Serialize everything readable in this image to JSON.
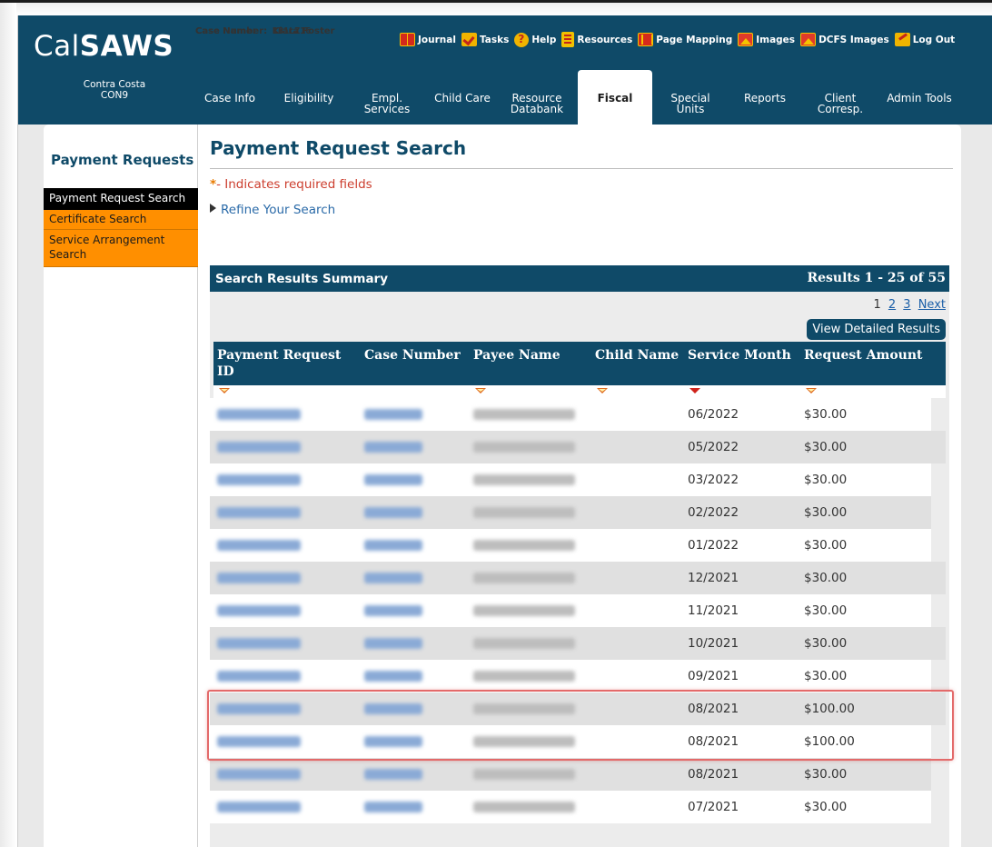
{
  "app": {
    "logo_cal": "Cal",
    "logo_saws": "SAWS",
    "case_name_label": "Case Name:",
    "case_name": "Kiara Foster",
    "case_number_label": "Case Number:",
    "case_number": "1B1LZ16"
  },
  "util_links": [
    {
      "label": "Journal",
      "icon": "journal-icon"
    },
    {
      "label": "Tasks",
      "icon": "tasks-icon"
    },
    {
      "label": "Help",
      "icon": "help-icon"
    },
    {
      "label": "Resources",
      "icon": "resources-icon"
    },
    {
      "label": "Page Mapping",
      "icon": "page-mapping-icon"
    },
    {
      "label": "Images",
      "icon": "images-icon"
    },
    {
      "label": "DCFS Images",
      "icon": "dcfs-images-icon"
    },
    {
      "label": "Log Out",
      "icon": "log-out-icon"
    }
  ],
  "county": {
    "name": "Contra Costa",
    "code": "CON9"
  },
  "nav_tabs": [
    {
      "line1": "Case Info",
      "line2": ""
    },
    {
      "line1": "Eligibility",
      "line2": ""
    },
    {
      "line1": "Empl.",
      "line2": "Services"
    },
    {
      "line1": "Child Care",
      "line2": ""
    },
    {
      "line1": "Resource",
      "line2": "Databank"
    },
    {
      "line1": "Fiscal",
      "line2": ""
    },
    {
      "line1": "Special",
      "line2": "Units"
    },
    {
      "line1": "Reports",
      "line2": ""
    },
    {
      "line1": "Client",
      "line2": "Corresp."
    },
    {
      "line1": "Admin Tools",
      "line2": ""
    }
  ],
  "active_tab": "Fiscal",
  "left_nav": {
    "title": "Payment Requests",
    "items": [
      {
        "label": "Payment Request Search",
        "label2": ""
      },
      {
        "label": "Certificate Search",
        "label2": ""
      },
      {
        "label": "Service Arrangement",
        "label2": "Search"
      }
    ]
  },
  "page": {
    "title": "Payment Request Search",
    "required_star": "*",
    "required_text": "- Indicates required fields",
    "refine_label": "Refine Your Search"
  },
  "results": {
    "summary_title": "Search Results Summary",
    "range_text": "Results 1 - 25 of 55",
    "pages": [
      "1",
      "2",
      "3"
    ],
    "next_label": "Next",
    "detailed_button": "View Detailed Results",
    "columns": [
      "Payment Request ID",
      "Case Number",
      "Payee Name",
      "Child Name",
      "Service Month",
      "Request Amount"
    ],
    "sort_state": [
      "asc",
      "none",
      "asc",
      "asc",
      "desc-active",
      "asc"
    ],
    "rows": [
      {
        "service_month": "06/2022",
        "request_amount": "$30.00"
      },
      {
        "service_month": "05/2022",
        "request_amount": "$30.00"
      },
      {
        "service_month": "03/2022",
        "request_amount": "$30.00"
      },
      {
        "service_month": "02/2022",
        "request_amount": "$30.00"
      },
      {
        "service_month": "01/2022",
        "request_amount": "$30.00"
      },
      {
        "service_month": "12/2021",
        "request_amount": "$30.00"
      },
      {
        "service_month": "11/2021",
        "request_amount": "$30.00"
      },
      {
        "service_month": "10/2021",
        "request_amount": "$30.00"
      },
      {
        "service_month": "09/2021",
        "request_amount": "$30.00"
      },
      {
        "service_month": "08/2021",
        "request_amount": "$100.00"
      },
      {
        "service_month": "08/2021",
        "request_amount": "$100.00"
      },
      {
        "service_month": "08/2021",
        "request_amount": "$30.00"
      },
      {
        "service_month": "07/2021",
        "request_amount": "$30.00"
      }
    ]
  },
  "colors": {
    "header_blue": "#0f4a68",
    "left_nav_orange": "#ff8f00",
    "required_red": "#cc3d2d",
    "highlight_red": "#e36a6a"
  }
}
